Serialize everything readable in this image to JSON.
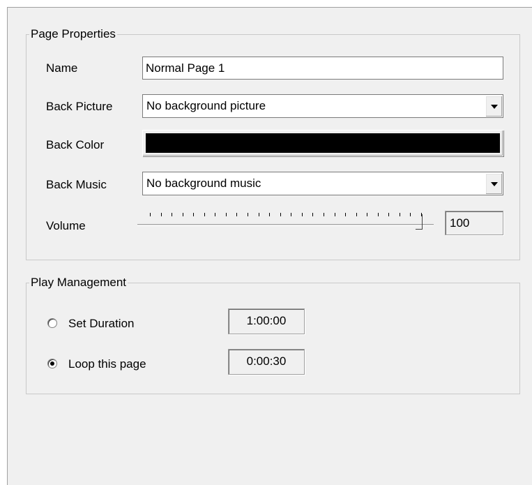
{
  "page_properties": {
    "title": "Page Properties",
    "name_label": "Name",
    "name_value": "Normal Page 1",
    "back_picture_label": "Back Picture",
    "back_picture_value": "No background picture",
    "back_color_label": "Back Color",
    "back_color_value": "#000000",
    "back_music_label": "Back Music",
    "back_music_value": "No background music",
    "volume_label": "Volume",
    "volume_value": "100",
    "volume_level": 1.0
  },
  "play_management": {
    "title": "Play Management",
    "set_duration_label": "Set Duration",
    "set_duration_value": "1:00:00",
    "set_duration_selected": false,
    "loop_label": "Loop this page",
    "loop_value": "0:00:30",
    "loop_selected": true
  },
  "icons": {
    "dropdown": "chevron-down-icon",
    "radio": "radio-button-icon"
  }
}
